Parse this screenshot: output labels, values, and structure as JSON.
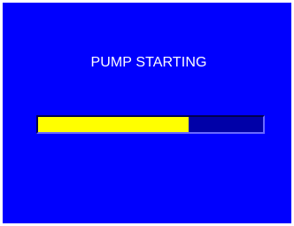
{
  "status": {
    "title": "PUMP STARTING"
  },
  "progress": {
    "fraction": 0.67
  },
  "colors": {
    "background": "#0000fe",
    "track": "#0000a8",
    "fill": "#ffff00",
    "text": "#ffffff"
  }
}
